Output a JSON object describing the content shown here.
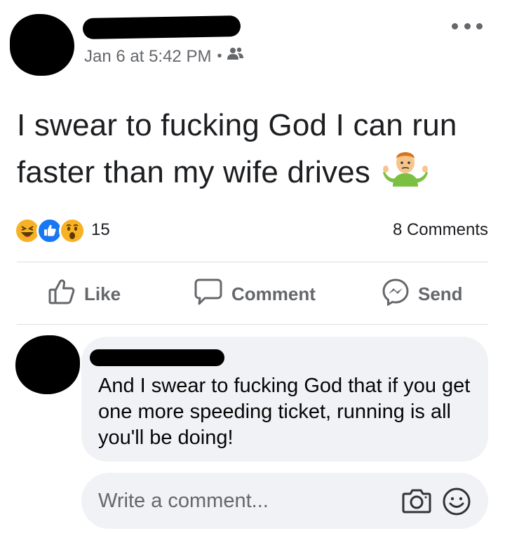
{
  "post": {
    "timestamp": "Jan 6 at 5:42 PM",
    "privacy_icon": "friends-icon",
    "text_line1": "I swear to fucking God I can run",
    "text_line2": "faster than my wife drives",
    "text_emoji": "🤷‍♂️"
  },
  "reactions": {
    "icons": [
      "haha-icon",
      "like-icon",
      "wow-icon"
    ],
    "count": "15",
    "comments_label": "8 Comments"
  },
  "actions": {
    "like_label": "Like",
    "comment_label": "Comment",
    "send_label": "Send"
  },
  "comment": {
    "text": "And I swear to fucking God that if you get one more speeding ticket, running is all you'll be doing!"
  },
  "composer": {
    "placeholder": "Write a comment..."
  },
  "colors": {
    "meta_gray": "#65676b",
    "bubble_bg": "#f0f2f5",
    "like_blue": "#1877f2",
    "reaction_yellow": "#f7b125"
  }
}
